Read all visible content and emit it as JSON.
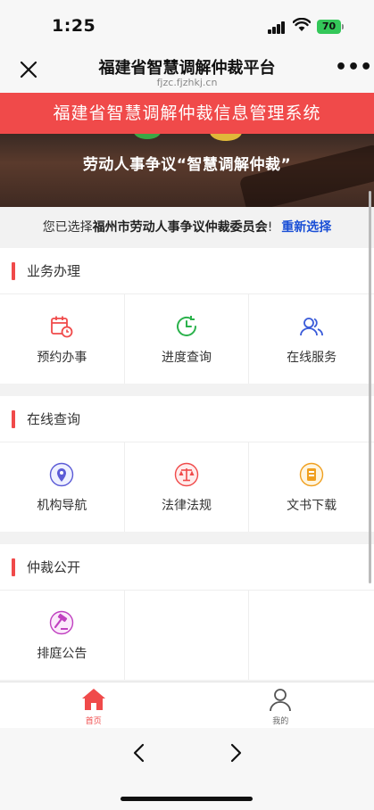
{
  "status": {
    "time": "1:25",
    "battery": "70"
  },
  "nav": {
    "title": "福建省智慧调解仲裁平台",
    "url": "fjzc.fjzhkj.cn"
  },
  "system_title": "福建省智慧调解仲裁信息管理系统",
  "hero_text": "劳动人事争议“智慧调解仲裁”",
  "selection": {
    "prefix": "您已选择",
    "org": "福州市劳动人事争议仲裁委员会",
    "suffix": "!",
    "reselect": "重新选择"
  },
  "sections": [
    {
      "title": "业务办理",
      "items": [
        {
          "label": "预约办事",
          "icon": "calendar-clock-icon",
          "color": "#f04a4a"
        },
        {
          "label": "进度查询",
          "icon": "progress-clock-icon",
          "color": "#2bb24c"
        },
        {
          "label": "在线服务",
          "icon": "users-icon",
          "color": "#3a5bd9"
        }
      ]
    },
    {
      "title": "在线查询",
      "items": [
        {
          "label": "机构导航",
          "icon": "location-pin-icon",
          "color": "#5b5bd6"
        },
        {
          "label": "法律法规",
          "icon": "scales-icon",
          "color": "#f04a4a"
        },
        {
          "label": "文书下载",
          "icon": "document-icon",
          "color": "#f0a020"
        }
      ]
    },
    {
      "title": "仲裁公开",
      "items": [
        {
          "label": "排庭公告",
          "icon": "gavel-icon",
          "color": "#c040c0"
        }
      ]
    }
  ],
  "tabs": [
    {
      "label": "首页",
      "icon": "home-icon",
      "active": true,
      "color": "#f04a4a"
    },
    {
      "label": "我的",
      "icon": "user-icon",
      "active": false,
      "color": "#666666"
    }
  ],
  "accent": "#f04a4a"
}
